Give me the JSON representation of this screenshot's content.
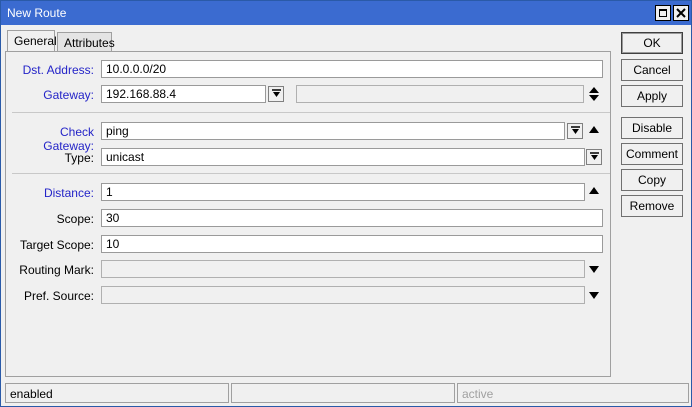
{
  "window": {
    "title": "New Route"
  },
  "tabs": [
    "General",
    "Attributes"
  ],
  "form": {
    "dst_address": {
      "label": "Dst. Address:",
      "value": "10.0.0.0/20"
    },
    "gateway": {
      "label": "Gateway:",
      "value": "192.168.88.4",
      "extra": ""
    },
    "check_gateway": {
      "label": "Check Gateway:",
      "value": "ping"
    },
    "type": {
      "label": "Type:",
      "value": "unicast"
    },
    "distance": {
      "label": "Distance:",
      "value": "1"
    },
    "scope": {
      "label": "Scope:",
      "value": "30"
    },
    "target_scope": {
      "label": "Target Scope:",
      "value": "10"
    },
    "routing_mark": {
      "label": "Routing Mark:",
      "value": ""
    },
    "pref_source": {
      "label": "Pref. Source:",
      "value": ""
    }
  },
  "buttons": {
    "ok": "OK",
    "cancel": "Cancel",
    "apply": "Apply",
    "disable": "Disable",
    "comment": "Comment",
    "copy": "Copy",
    "remove": "Remove"
  },
  "status": {
    "left": "enabled",
    "middle": "",
    "right": "active"
  },
  "colors": {
    "titlebar": "#3b6bd0",
    "label_blue": "#2424c8"
  }
}
